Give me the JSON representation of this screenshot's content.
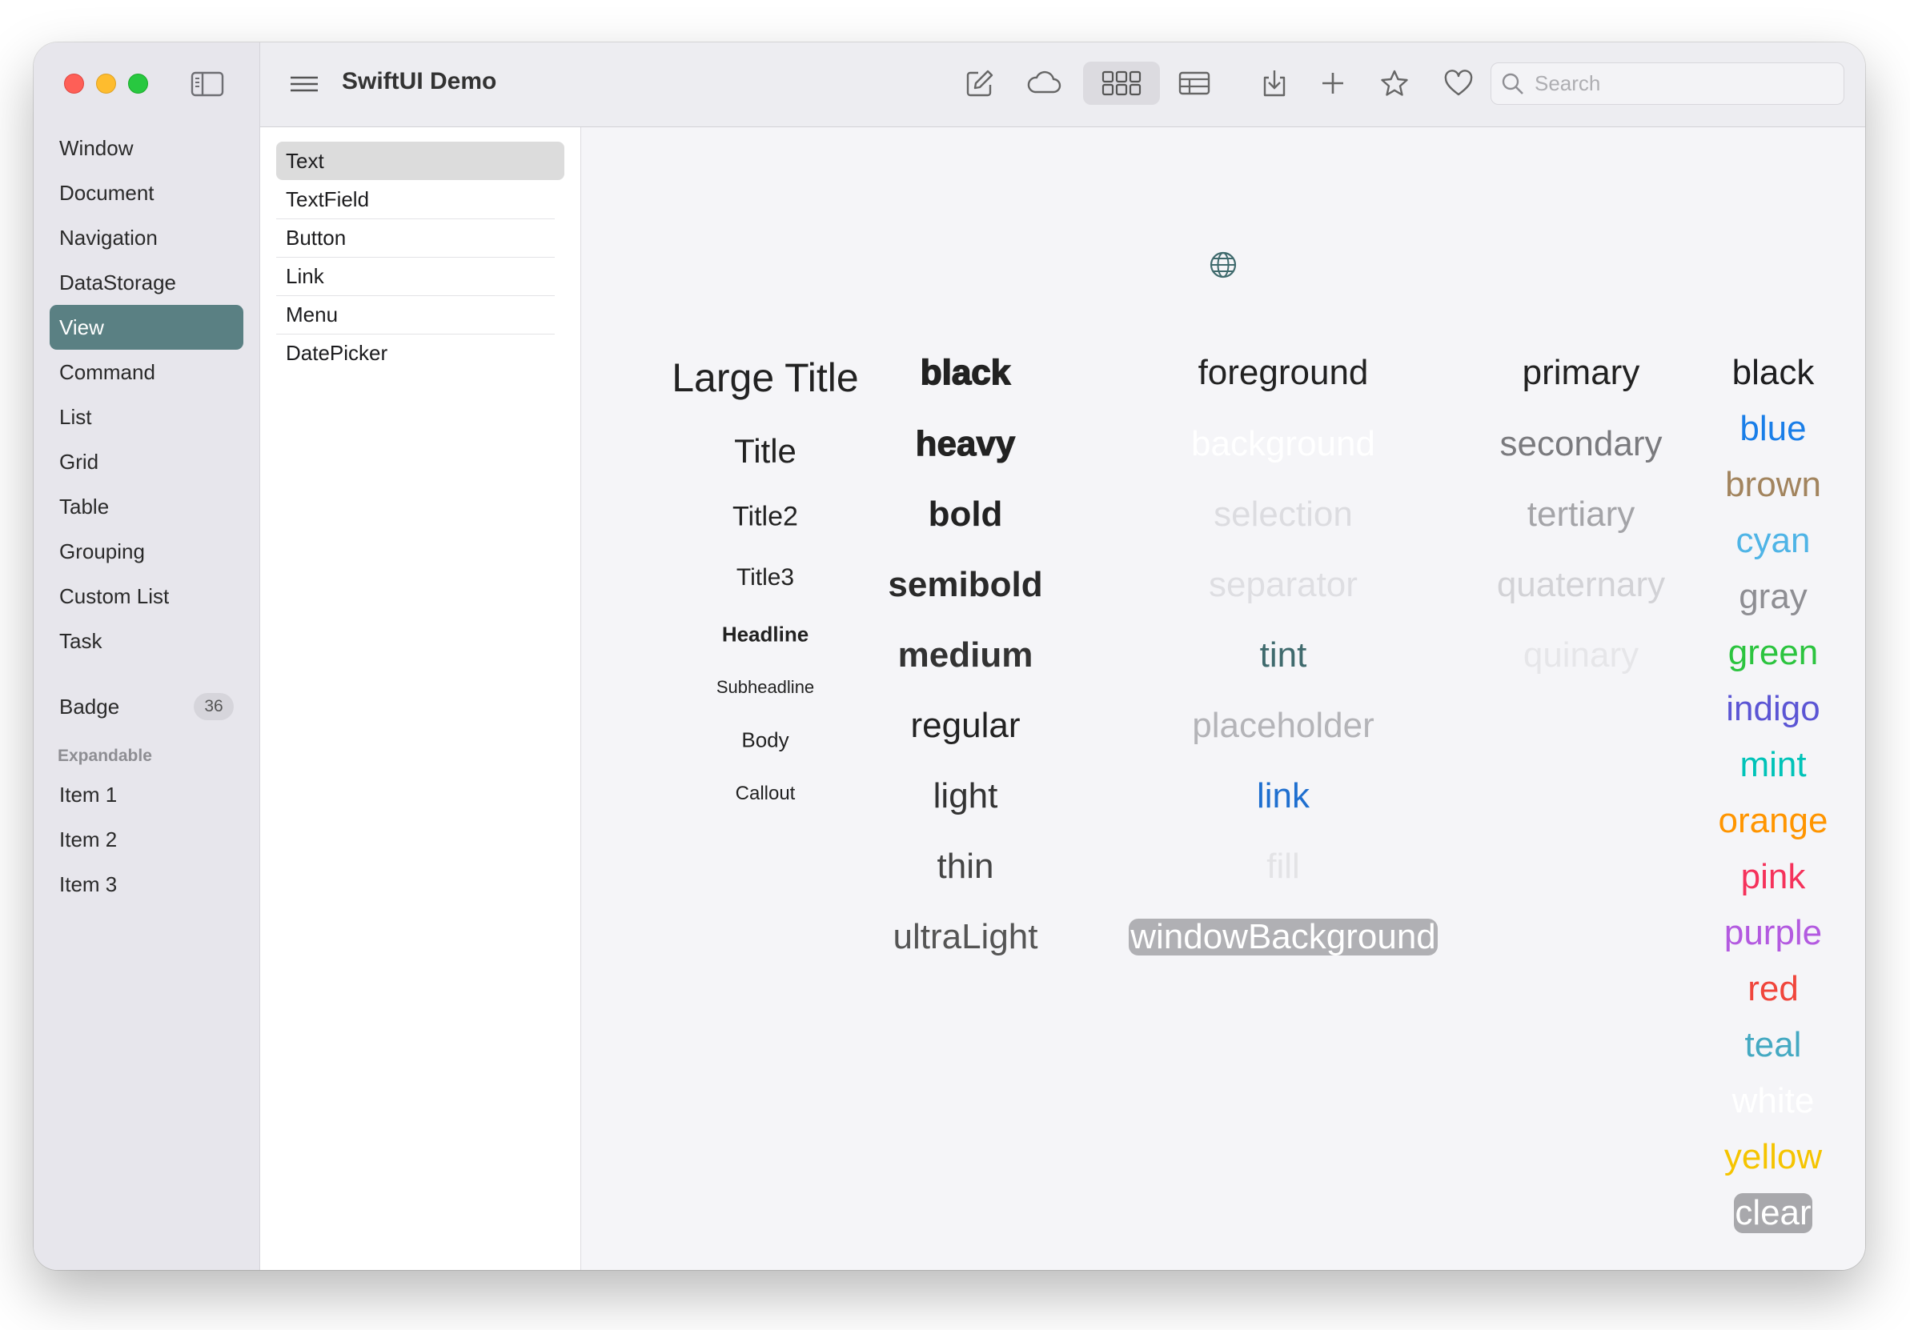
{
  "window": {
    "title": "SwiftUI Demo"
  },
  "sidebar": {
    "items": [
      {
        "label": "Window"
      },
      {
        "label": "Document"
      },
      {
        "label": "Navigation"
      },
      {
        "label": "DataStorage"
      },
      {
        "label": "View",
        "selected": true
      },
      {
        "label": "Command"
      },
      {
        "label": "List"
      },
      {
        "label": "Grid"
      },
      {
        "label": "Table"
      },
      {
        "label": "Grouping"
      },
      {
        "label": "Custom List"
      },
      {
        "label": "Task"
      }
    ],
    "badge_item": {
      "label": "Badge",
      "count": "36"
    },
    "section_header": "Expandable",
    "expandable_items": [
      {
        "label": "Item 1"
      },
      {
        "label": "Item 2"
      },
      {
        "label": "Item 3"
      }
    ]
  },
  "toolbar": {
    "icons": [
      "compose-icon",
      "cloud-icon",
      "grid-view-icon",
      "table-view-icon",
      "download-icon",
      "plus-icon",
      "star-icon",
      "heart-icon"
    ],
    "selected_view": "grid-view-icon",
    "search": {
      "placeholder": "Search",
      "value": ""
    }
  },
  "content_list": {
    "items": [
      "Text",
      "TextField",
      "Button",
      "Link",
      "Menu",
      "DatePicker"
    ],
    "selected": "Text"
  },
  "detail": {
    "header_icon": "globe-icon",
    "font_styles": [
      "Large Title",
      "Title",
      "Title2",
      "Title3",
      "Headline",
      "Subheadline",
      "Body",
      "Callout"
    ],
    "font_weights": [
      "black",
      "heavy",
      "bold",
      "semibold",
      "medium",
      "regular",
      "light",
      "thin",
      "ultraLight"
    ],
    "semantic_styles": [
      "foreground",
      "background",
      "selection",
      "separator",
      "tint",
      "placeholder",
      "link",
      "fill",
      "windowBackground"
    ],
    "hierarchical_styles": [
      "primary",
      "secondary",
      "tertiary",
      "quaternary",
      "quinary"
    ],
    "colors": [
      {
        "name": "black",
        "hex": "#1d1d1f"
      },
      {
        "name": "blue",
        "hex": "#1a7ee8"
      },
      {
        "name": "brown",
        "hex": "#a2845e"
      },
      {
        "name": "cyan",
        "hex": "#4fb4e6"
      },
      {
        "name": "gray",
        "hex": "#8e8e93"
      },
      {
        "name": "green",
        "hex": "#2cc43f"
      },
      {
        "name": "indigo",
        "hex": "#5b55d4"
      },
      {
        "name": "mint",
        "hex": "#00c3b8"
      },
      {
        "name": "orange",
        "hex": "#ff9500"
      },
      {
        "name": "pink",
        "hex": "#f5325b"
      },
      {
        "name": "purple",
        "hex": "#b35ae0"
      },
      {
        "name": "red",
        "hex": "#f0463c"
      },
      {
        "name": "teal",
        "hex": "#44a9c2"
      },
      {
        "name": "white",
        "hex": "#ffffff"
      },
      {
        "name": "yellow",
        "hex": "#f5c400"
      },
      {
        "name": "clear",
        "hex": "#a8a8ac"
      }
    ]
  }
}
